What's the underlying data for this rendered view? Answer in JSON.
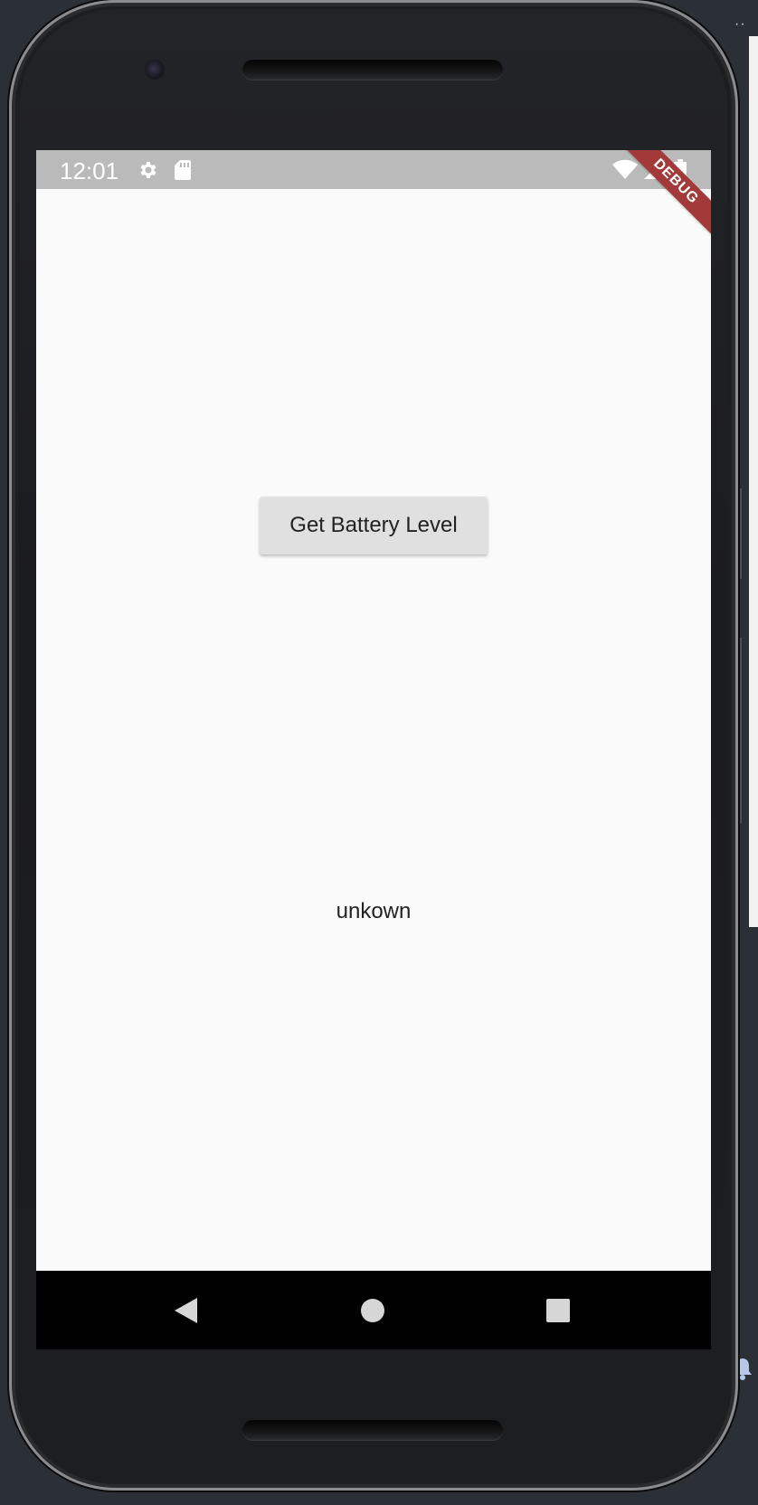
{
  "status_bar": {
    "time": "12:01",
    "left_icons": [
      "gear-icon",
      "sd-card-icon"
    ],
    "right_icons": [
      "wifi-off-icon",
      "signal-icon",
      "battery-icon"
    ],
    "debug_label": "DEBUG"
  },
  "main": {
    "button_label": "Get Battery Level",
    "battery_level_text": "unkown"
  },
  "nav_bar": {
    "buttons": [
      "back-icon",
      "home-icon",
      "recents-icon"
    ]
  },
  "colors": {
    "status_bar": "#bababa",
    "screen_background": "#fafafa",
    "button_background": "#e0e0e0",
    "debug_banner": "#a33a3a",
    "nav_bar": "#000000"
  }
}
